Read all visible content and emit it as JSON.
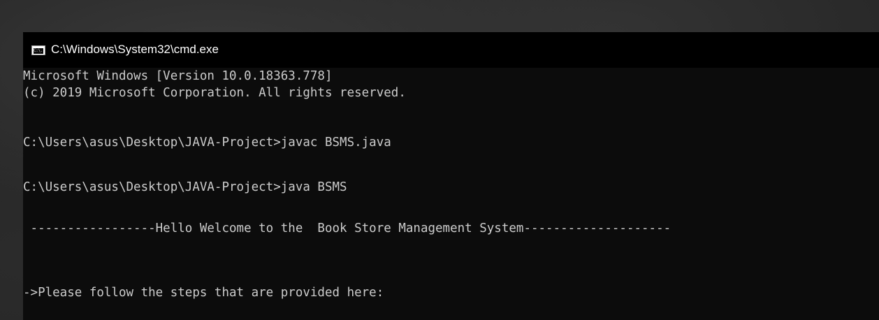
{
  "window": {
    "title": "C:\\Windows\\System32\\cmd.exe",
    "icon": "cmd-icon",
    "icon_text": "C:\\."
  },
  "console": {
    "lines": [
      "Microsoft Windows [Version 10.0.18363.778]",
      "(c) 2019 Microsoft Corporation. All rights reserved.",
      "",
      "C:\\Users\\asus\\Desktop\\JAVA-Project>javac BSMS.java",
      "",
      "C:\\Users\\asus\\Desktop\\JAVA-Project>java BSMS",
      "",
      " -----------------Hello Welcome to the  Book Store Management System--------------------",
      "",
      "",
      "->Please follow the steps that are provided here:"
    ]
  },
  "colors": {
    "background": "#0c0c0c",
    "text": "#cccccc",
    "titlebar": "#000000",
    "title_text": "#ffffff"
  }
}
